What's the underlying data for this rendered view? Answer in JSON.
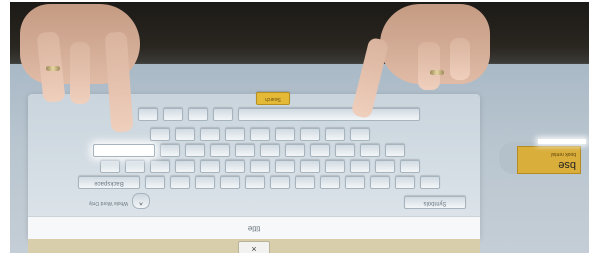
{
  "scene": {
    "description_tags": [
      "hands-on-table",
      "touch-surface",
      "virtual-keyboard"
    ]
  },
  "keyboard": {
    "title": "title",
    "search_label": "Search",
    "symbols_label": "Symbols",
    "backspace_label": "Backspace",
    "whole_word_hint": "Whole Word Only",
    "close_label": "×",
    "shift_icon": "caret-up-icon"
  },
  "tag": {
    "label": "bse",
    "sub": "book rental"
  },
  "colors": {
    "accent_yellow": "#e4b935",
    "tag_gold": "#d9ae3a",
    "panel": "#dfe6ec",
    "table": "#b8c5cf"
  }
}
